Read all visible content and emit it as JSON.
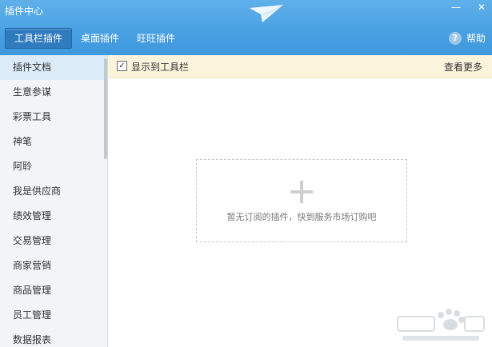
{
  "window": {
    "title": "插件中心"
  },
  "tabs": [
    {
      "label": "工具栏插件",
      "active": true
    },
    {
      "label": "桌面插件",
      "active": false
    },
    {
      "label": "旺旺插件",
      "active": false
    }
  ],
  "help": {
    "label": "帮助",
    "icon": "help-icon"
  },
  "sidebar": {
    "items": [
      {
        "label": "插件文档"
      },
      {
        "label": "生意参谋"
      },
      {
        "label": "彩票工具"
      },
      {
        "label": "神笔"
      },
      {
        "label": "阿聆"
      },
      {
        "label": "我是供应商"
      },
      {
        "label": "绩效管理"
      },
      {
        "label": "交易管理"
      },
      {
        "label": "商家营销"
      },
      {
        "label": "商品管理"
      },
      {
        "label": "员工管理"
      },
      {
        "label": "数据报表"
      }
    ]
  },
  "notice": {
    "checkbox_label": "显示到工具栏",
    "checked": true,
    "view_more": "查看更多"
  },
  "empty": {
    "message": "暂无订阅的插件，快到服务市场订购吧"
  },
  "colors": {
    "titlebar": "#4aa3e4",
    "sidebar_bg": "#f2f4f6",
    "notice_bg": "#fbf3dc",
    "selected": "#dcebf8"
  }
}
